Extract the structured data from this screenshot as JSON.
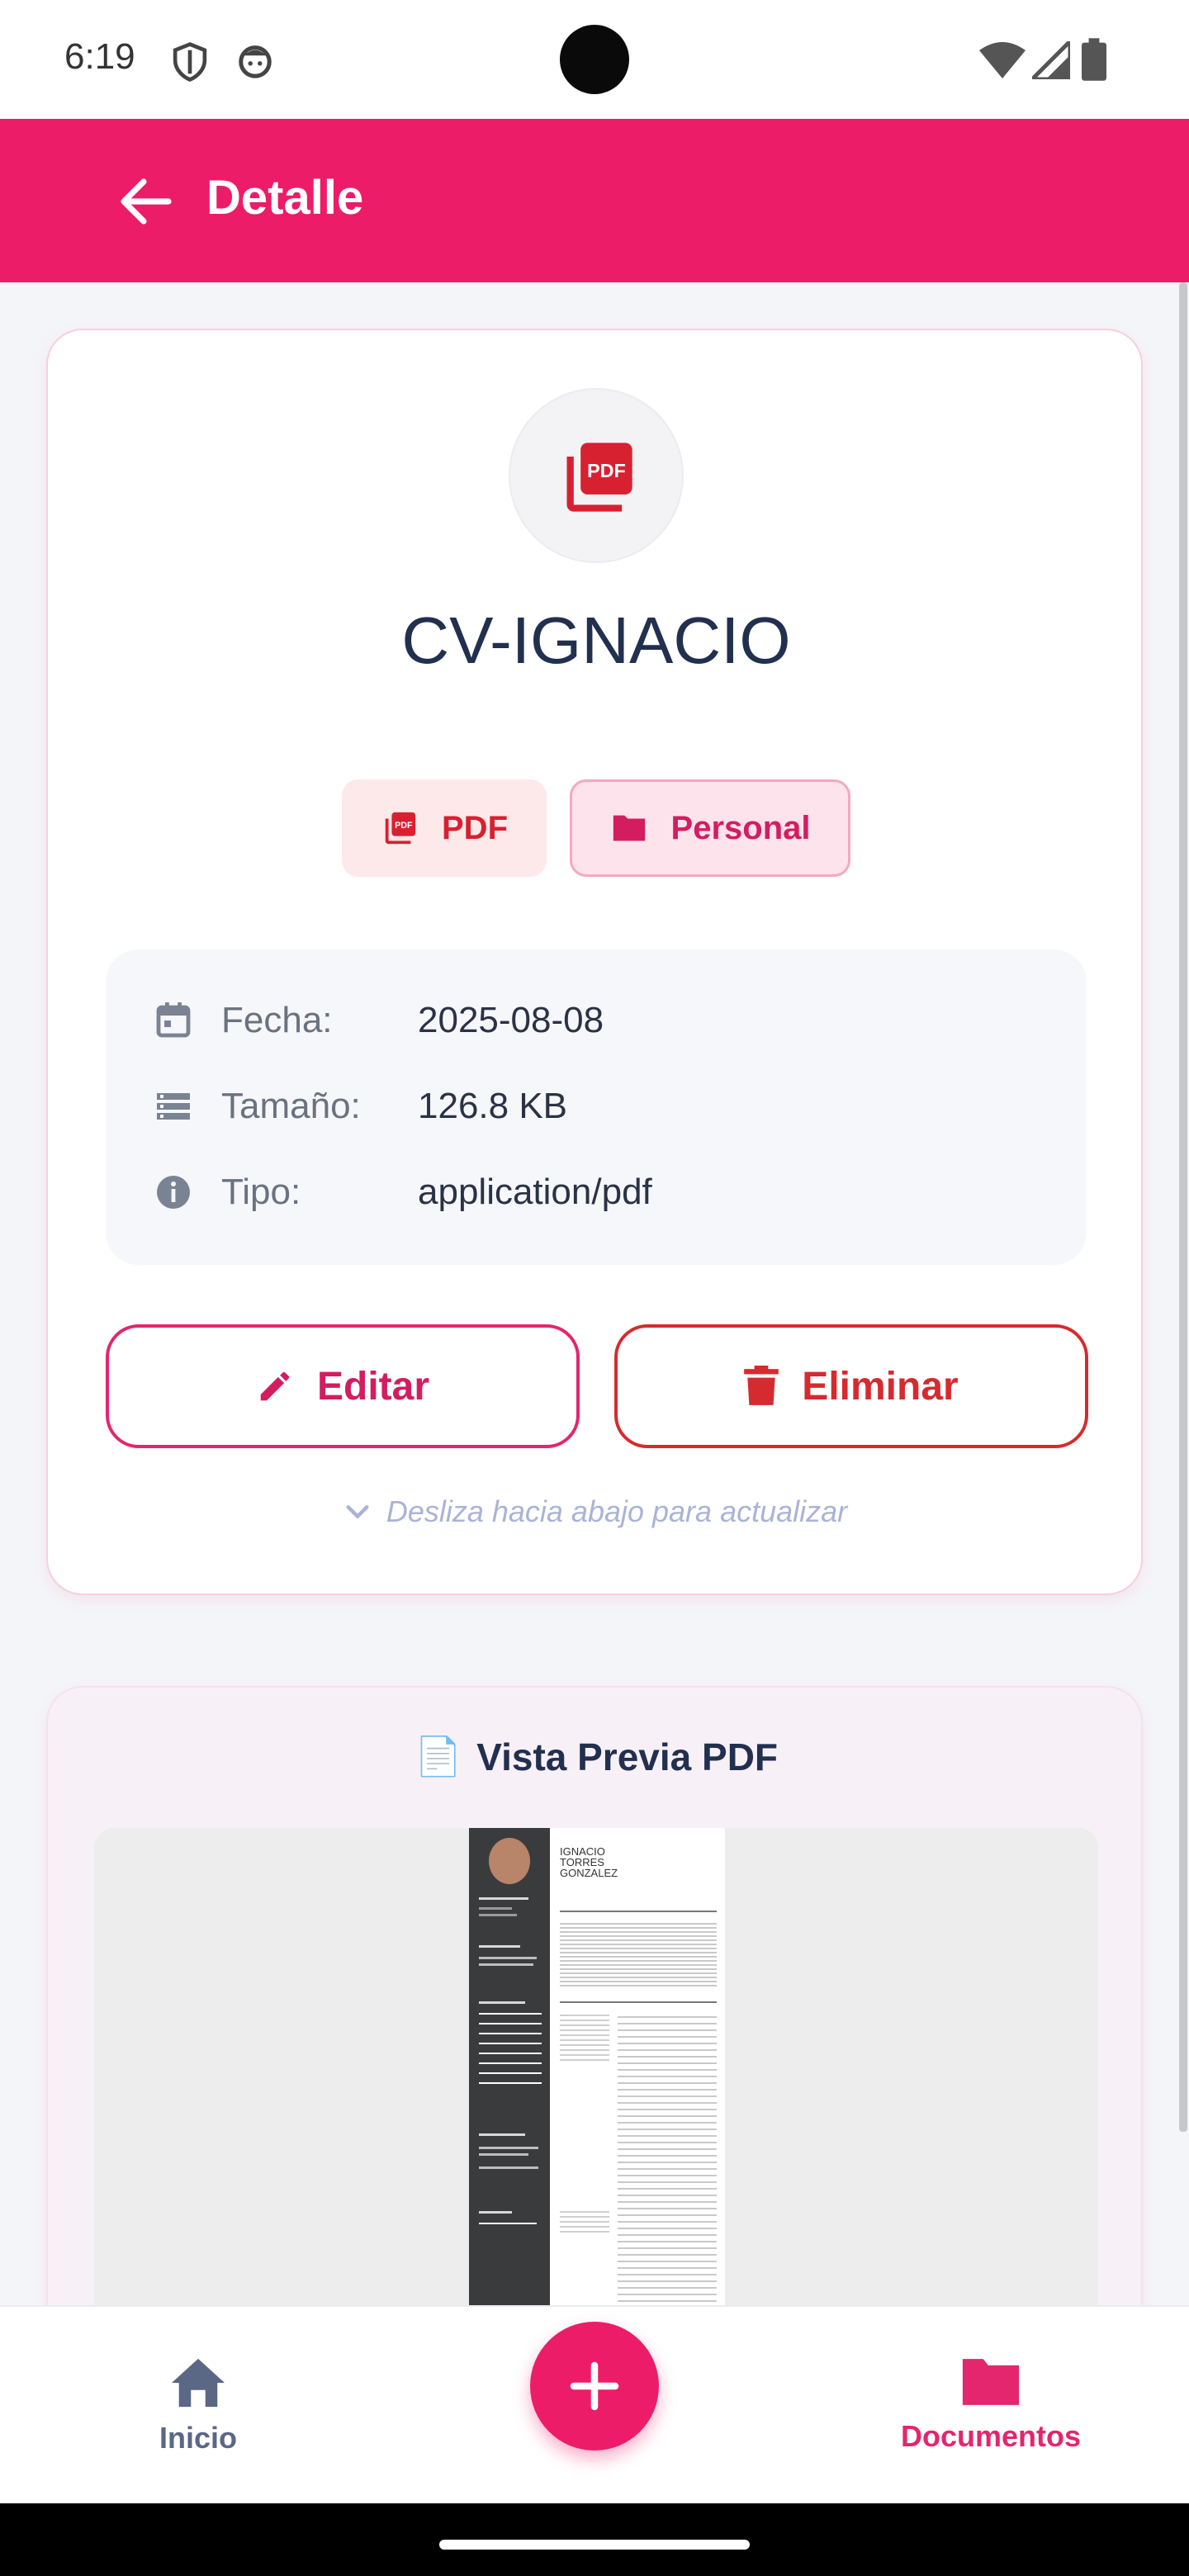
{
  "status_bar": {
    "time": "6:19"
  },
  "app_bar": {
    "title": "Detalle"
  },
  "document": {
    "title": "CV-IGNACIO",
    "type_chip": "PDF",
    "category_chip": "Personal",
    "info": [
      {
        "label": "Fecha:",
        "value": "2025-08-08",
        "icon": "calendar-icon"
      },
      {
        "label": "Tamaño:",
        "value": "126.8 KB",
        "icon": "storage-icon"
      },
      {
        "label": "Tipo:",
        "value": "application/pdf",
        "icon": "info-icon"
      }
    ]
  },
  "actions": {
    "edit_label": "Editar",
    "delete_label": "Eliminar"
  },
  "refresh_hint": "Desliza hacia abajo para actualizar",
  "preview": {
    "title": "Vista Previa PDF",
    "icon": "📄",
    "page_header": [
      "IGNACIO",
      "TORRES",
      "GONZALEZ"
    ]
  },
  "bottom_nav": {
    "home_label": "Inicio",
    "documents_label": "Documentos",
    "active": "Documentos"
  },
  "colors": {
    "primary": "#ec1c68",
    "danger": "#d52b2f",
    "title_text": "#22304f"
  }
}
